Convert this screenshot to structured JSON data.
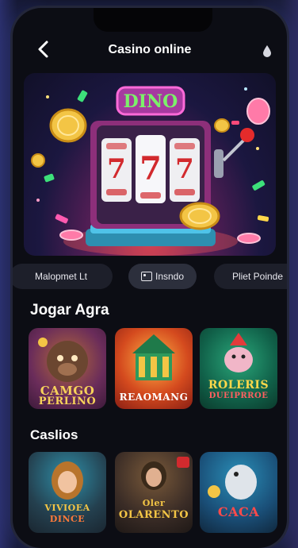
{
  "header": {
    "title": "Casino online"
  },
  "hero": {
    "sign_text": "DINO"
  },
  "filters": [
    {
      "label": "Malopmet Lt"
    },
    {
      "label": "Insndo"
    },
    {
      "label": "Pliet Poinde"
    }
  ],
  "sections": [
    {
      "title": "Jogar Agra",
      "cards": [
        {
          "line1": "CAMGO",
          "line2": "PERLINO"
        },
        {
          "line1": "REAOMANG",
          "line2": ""
        },
        {
          "line1": "ROLERIS",
          "line2": "DUEIPRROE"
        }
      ]
    },
    {
      "title": "Caslios",
      "cards": [
        {
          "line1": "VIVIOEA",
          "line2": "DINCE"
        },
        {
          "line1": "Oler",
          "line2": "OLARENTO"
        },
        {
          "line1": "CACA",
          "line2": ""
        }
      ]
    }
  ],
  "colors": {
    "background": "#101223",
    "chip": "#1d1f2a",
    "accent_gold": "#f3c545",
    "accent_red": "#d22a2e"
  }
}
